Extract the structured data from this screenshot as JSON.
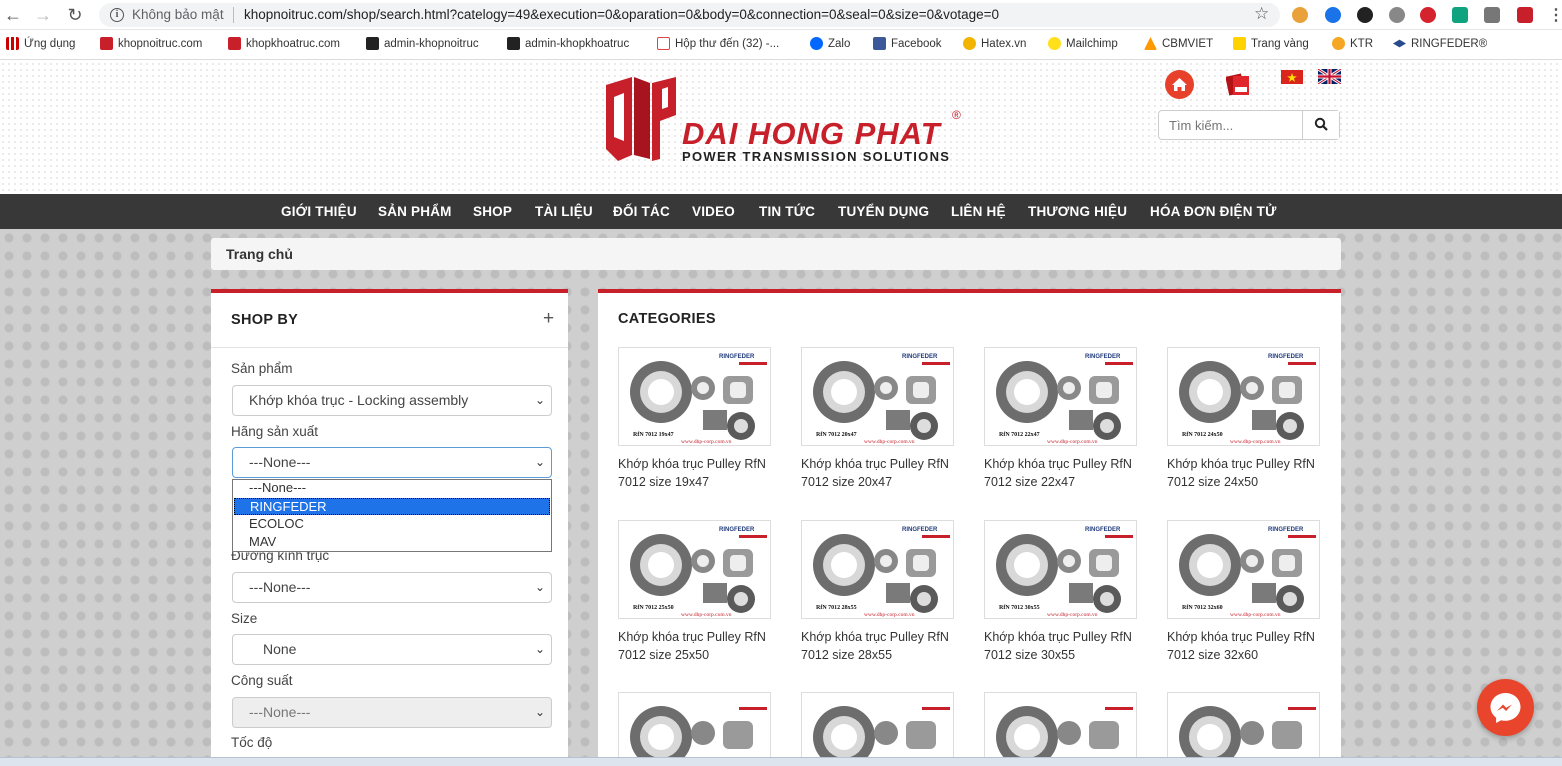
{
  "browser": {
    "security_label": "Không bảo mật",
    "url": "khopnoitruc.com/shop/search.html?catelogy=49&execution=0&oparation=0&body=0&connection=0&seal=0&size=0&votage=0",
    "bookmarks": [
      "Ứng dụng",
      "khopnoitruc.com",
      "khopkhoatruc.com",
      "admin-khopnoitruc",
      "admin-khopkhoatruc",
      "Hộp thư đến (32) -...",
      "Zalo",
      "Facebook",
      "Hatex.vn",
      "Mailchimp",
      "CBMVIET",
      "Trang vàng",
      "KTR",
      "RINGFEDER®"
    ]
  },
  "header": {
    "logo_name": "DAI HONG PHAT",
    "logo_reg": "®",
    "logo_tagline": "POWER TRANSMISSION SOLUTIONS",
    "search_placeholder": "Tìm kiếm..."
  },
  "menu": [
    "GIỚI THIỆU",
    "SẢN PHẨM",
    "SHOP",
    "TÀI LIỆU",
    "ĐỐI TÁC",
    "VIDEO",
    "TIN TỨC",
    "TUYỂN DỤNG",
    "LIÊN HỆ",
    "THƯƠNG HIỆU",
    "HÓA ĐƠN ĐIỆN TỬ"
  ],
  "breadcrumb": "Trang chủ",
  "sidebar": {
    "title": "SHOP BY",
    "toggle": "+",
    "filters": [
      {
        "label": "Sản phẩm",
        "value": "Khớp khóa trục - Locking assembly"
      },
      {
        "label": "Hãng sản xuất",
        "value": "---None---"
      },
      {
        "label": "Đường kính trục",
        "value": "---None---"
      },
      {
        "label": "Size",
        "value": "None"
      },
      {
        "label": "Công suất",
        "value": "---None---"
      },
      {
        "label": "Tốc độ",
        "value": ""
      }
    ],
    "dropdown_options": [
      "---None---",
      "RINGFEDER",
      "ECOLOC",
      "MAV"
    ],
    "dropdown_selected": "RINGFEDER"
  },
  "main": {
    "title": "CATEGORIES",
    "thumb_brand": "RINGFEDER",
    "products": [
      {
        "name": "Khớp khóa trục Pulley RfN 7012 size 19x47",
        "tag": "RfN 7012 19x47"
      },
      {
        "name": "Khớp khóa trục Pulley RfN 7012 size 20x47",
        "tag": "RfN 7012 20x47"
      },
      {
        "name": "Khớp khóa trục Pulley RfN 7012 size 22x47",
        "tag": "RfN 7012 22x47"
      },
      {
        "name": "Khớp khóa trục Pulley RfN 7012 size 24x50",
        "tag": "RfN 7012 24x50"
      },
      {
        "name": "Khớp khóa trục Pulley RfN 7012 size 25x50",
        "tag": "RfN 7012 25x50"
      },
      {
        "name": "Khớp khóa trục Pulley RfN 7012 size 28x55",
        "tag": "RfN 7012 28x55"
      },
      {
        "name": "Khớp khóa trục Pulley RfN 7012 size 30x55",
        "tag": "RfN 7012 30x55"
      },
      {
        "name": "Khớp khóa trục Pulley RfN 7012 size 32x60",
        "tag": "RfN 7012 32x60"
      }
    ],
    "thumb_url": "www.dhp-corp.com.vn"
  },
  "colors": {
    "brand_red": "#c8202a",
    "menu_bg": "#383838",
    "selected_option": "#1e73e8"
  }
}
